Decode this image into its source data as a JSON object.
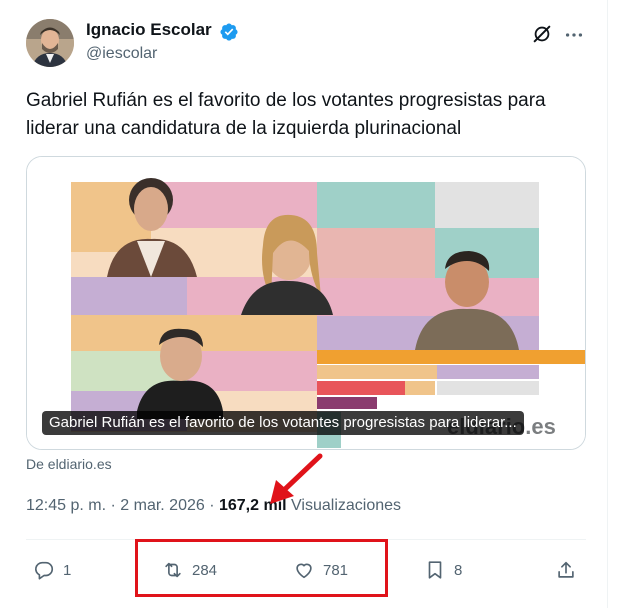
{
  "author": {
    "name": "Ignacio Escolar",
    "handle": "@iescolar"
  },
  "tweet": {
    "text": "Gabriel Rufián es el favorito de los  votantes progresistas para liderar una candidatura de la izquierda  plurinacional"
  },
  "card": {
    "caption": "Gabriel Rufián es el favorito de los votantes progresistas para liderar...",
    "watermark": "eldiario.es",
    "source": "De eldiario.es"
  },
  "meta": {
    "time": "12:45 p. m.",
    "sep1": " · ",
    "date": "2 mar. 2026",
    "sep2": " · ",
    "views_count": "167,2 mil",
    "views_label": " Visualizaciones"
  },
  "actions": {
    "reply_count": "1",
    "repost_count": "284",
    "like_count": "781",
    "bookmark_count": "8"
  },
  "colors": {
    "annotation": "#e0131a",
    "verified": "#1d9bf0",
    "muted": "#536471"
  }
}
